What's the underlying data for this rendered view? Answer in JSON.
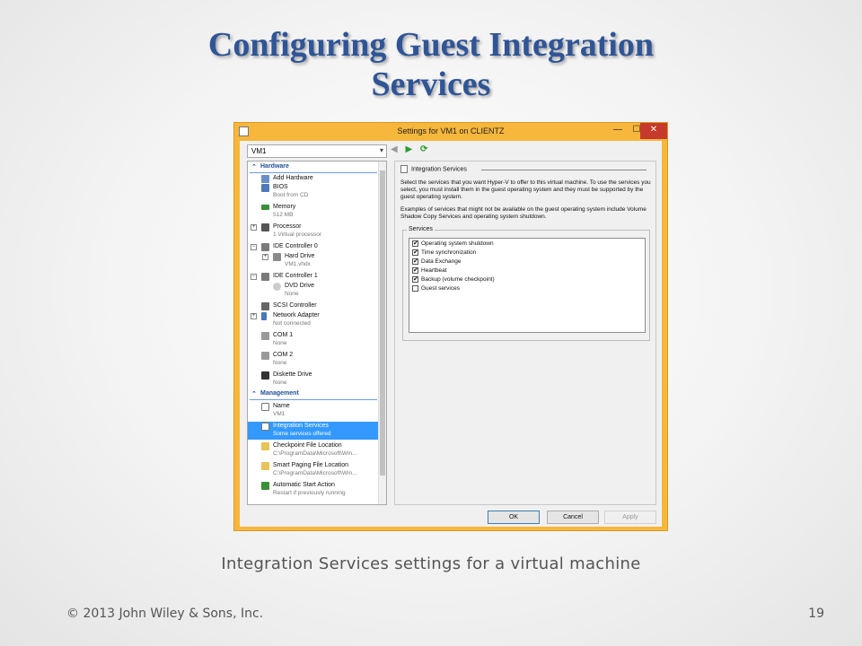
{
  "slide": {
    "title_line1": "Configuring Guest Integration",
    "title_line2": "Services",
    "caption": "Integration Services settings for a virtual machine",
    "copyright": "© 2013 John Wiley & Sons, Inc.",
    "page_number": "19"
  },
  "window": {
    "title": "Settings for VM1 on CLIENTZ",
    "min_glyph": "—",
    "max_glyph": "☐",
    "close_glyph": "✕"
  },
  "vm_selector": {
    "value": "VM1",
    "arrow_glyph": "▾"
  },
  "nav": {
    "prev_glyph": "◀",
    "next_glyph": "▶",
    "refresh_glyph": "⟳"
  },
  "tree": {
    "hardware_header": "Hardware",
    "management_header": "Management",
    "hardware": [
      {
        "label": "Add Hardware",
        "sub": ""
      },
      {
        "label": "BIOS",
        "sub": "Boot from CD"
      },
      {
        "label": "Memory",
        "sub": "512 MB"
      },
      {
        "label": "Processor",
        "sub": "1 Virtual processor"
      },
      {
        "label": "IDE Controller 0",
        "sub": ""
      },
      {
        "label": "Hard Drive",
        "sub": "VM1.vhdx"
      },
      {
        "label": "IDE Controller 1",
        "sub": ""
      },
      {
        "label": "DVD Drive",
        "sub": "None"
      },
      {
        "label": "SCSI Controller",
        "sub": ""
      },
      {
        "label": "Network Adapter",
        "sub": "Not connected"
      },
      {
        "label": "COM 1",
        "sub": "None"
      },
      {
        "label": "COM 2",
        "sub": "None"
      },
      {
        "label": "Diskette Drive",
        "sub": "None"
      }
    ],
    "management": [
      {
        "label": "Name",
        "sub": "VM1"
      },
      {
        "label": "Integration Services",
        "sub": "Some services offered"
      },
      {
        "label": "Checkpoint File Location",
        "sub": "C:\\ProgramData\\Microsoft\\Win..."
      },
      {
        "label": "Smart Paging File Location",
        "sub": "C:\\ProgramData\\Microsoft\\Win..."
      },
      {
        "label": "Automatic Start Action",
        "sub": "Restart if previously running"
      }
    ]
  },
  "panel": {
    "header": "Integration Services",
    "desc1": "Select the services that you want Hyper-V to offer to this virtual machine. To use the services you select, you must install them in the guest operating system and they must be supported by the guest operating system.",
    "desc2": "Examples of services that might not be available on the guest operating system include Volume Shadow Copy Services and operating system shutdown.",
    "services_legend": "Services",
    "services": [
      {
        "label": "Operating system shutdown",
        "checked": true
      },
      {
        "label": "Time synchronization",
        "checked": true
      },
      {
        "label": "Data Exchange",
        "checked": true
      },
      {
        "label": "Heartbeat",
        "checked": true
      },
      {
        "label": "Backup (volume checkpoint)",
        "checked": true
      },
      {
        "label": "Guest services",
        "checked": false
      }
    ],
    "check_glyph": "✔"
  },
  "buttons": {
    "ok": "OK",
    "cancel": "Cancel",
    "apply": "Apply"
  }
}
